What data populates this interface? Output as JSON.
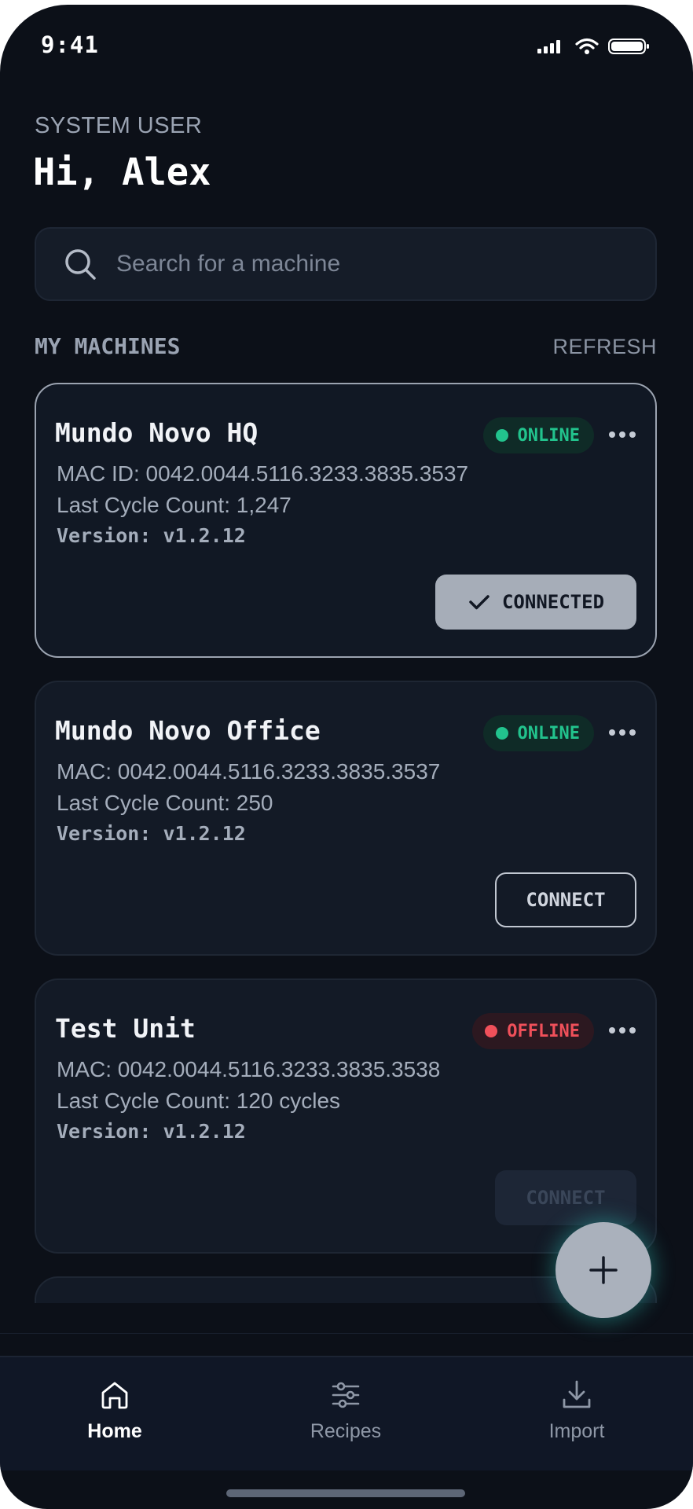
{
  "status_bar": {
    "time": "9:41"
  },
  "header": {
    "eyebrow": "SYSTEM USER",
    "greeting": "Hi, Alex"
  },
  "search": {
    "placeholder": "Search for a machine",
    "value": ""
  },
  "section": {
    "title": "MY MACHINES",
    "refresh_label": "REFRESH"
  },
  "machines": [
    {
      "name": "Mundo Novo HQ",
      "status": "ONLINE",
      "mac": "MAC ID: 0042.0044.5116.3233.3835.3537",
      "cycles": "Last Cycle Count: 1,247",
      "version": "Version: v1.2.12",
      "button_label": "CONNECTED"
    },
    {
      "name": "Mundo Novo Office",
      "status": "ONLINE",
      "mac": "MAC: 0042.0044.5116.3233.3835.3537",
      "cycles": "Last Cycle Count: 250",
      "version": "Version: v1.2.12",
      "button_label": "CONNECT"
    },
    {
      "name": "Test Unit",
      "status": "OFFLINE",
      "mac": "MAC: 0042.0044.5116.3233.3835.3538",
      "cycles": "Last Cycle Count: 120 cycles",
      "version": "Version: v1.2.12",
      "button_label": "CONNECT"
    }
  ],
  "tabs": [
    {
      "label": "Home",
      "icon": "home-icon",
      "active": true
    },
    {
      "label": "Recipes",
      "icon": "sliders-icon",
      "active": false
    },
    {
      "label": "Import",
      "icon": "download-icon",
      "active": false
    }
  ],
  "colors": {
    "background": "#0c1018",
    "card": "#131a26",
    "online": "#22c38d",
    "offline": "#f0505a",
    "fab_glow": "#2db4aa"
  }
}
